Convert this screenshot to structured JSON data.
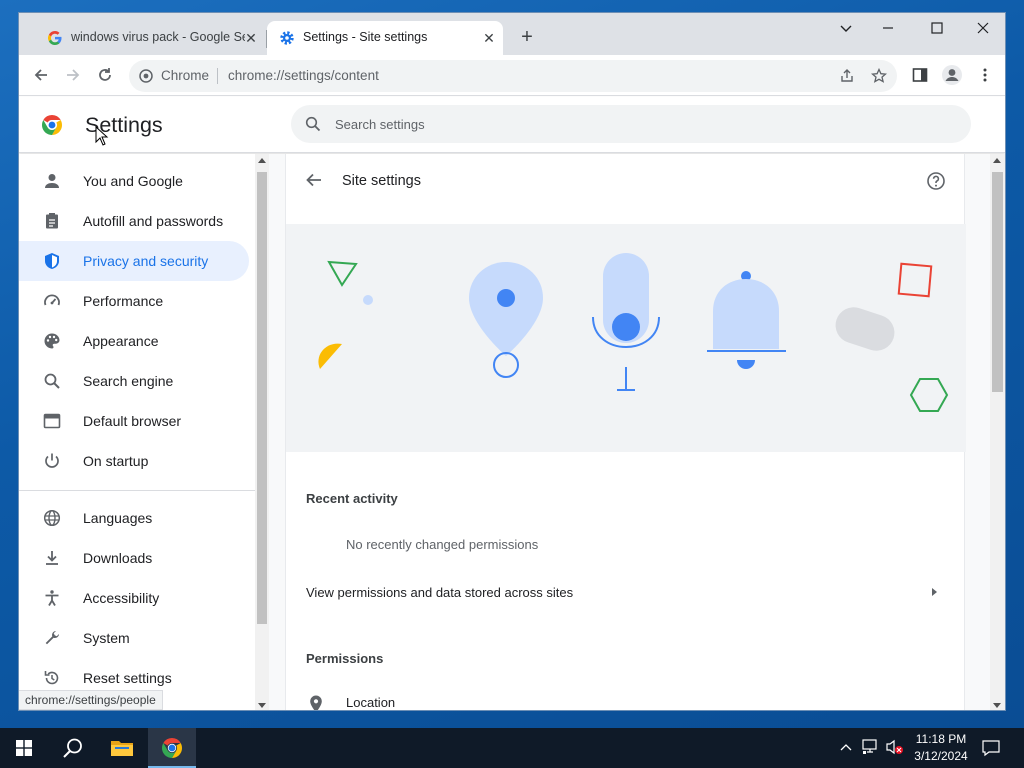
{
  "tabs": [
    {
      "title": "windows virus pack - Google Sea",
      "active": false
    },
    {
      "title": "Settings - Site settings",
      "active": true
    }
  ],
  "omnibox": {
    "chip": "Chrome",
    "url": "chrome://settings/content"
  },
  "settings": {
    "title": "Settings",
    "search_placeholder": "Search settings"
  },
  "sidebar": {
    "items": [
      {
        "label": "You and Google",
        "icon": "person-icon"
      },
      {
        "label": "Autofill and passwords",
        "icon": "clipboard-icon"
      },
      {
        "label": "Privacy and security",
        "icon": "shield-icon",
        "active": true
      },
      {
        "label": "Performance",
        "icon": "speedometer-icon"
      },
      {
        "label": "Appearance",
        "icon": "palette-icon"
      },
      {
        "label": "Search engine",
        "icon": "search-icon"
      },
      {
        "label": "Default browser",
        "icon": "browser-icon"
      },
      {
        "label": "On startup",
        "icon": "power-icon"
      },
      {
        "label": "Languages",
        "icon": "globe-icon"
      },
      {
        "label": "Downloads",
        "icon": "download-icon"
      },
      {
        "label": "Accessibility",
        "icon": "accessibility-icon"
      },
      {
        "label": "System",
        "icon": "wrench-icon"
      },
      {
        "label": "Reset settings",
        "icon": "reset-icon"
      }
    ]
  },
  "main": {
    "page_title": "Site settings",
    "recent_activity_heading": "Recent activity",
    "recent_activity_empty": "No recently changed permissions",
    "view_permissions_label": "View permissions and data stored across sites",
    "permissions_heading": "Permissions",
    "location_label": "Location"
  },
  "status_url": "chrome://settings/people",
  "taskbar": {
    "time": "11:18 PM",
    "date": "3/12/2024"
  },
  "colors": {
    "accent": "#1a73e8",
    "active_bg": "#e8f0fe"
  }
}
